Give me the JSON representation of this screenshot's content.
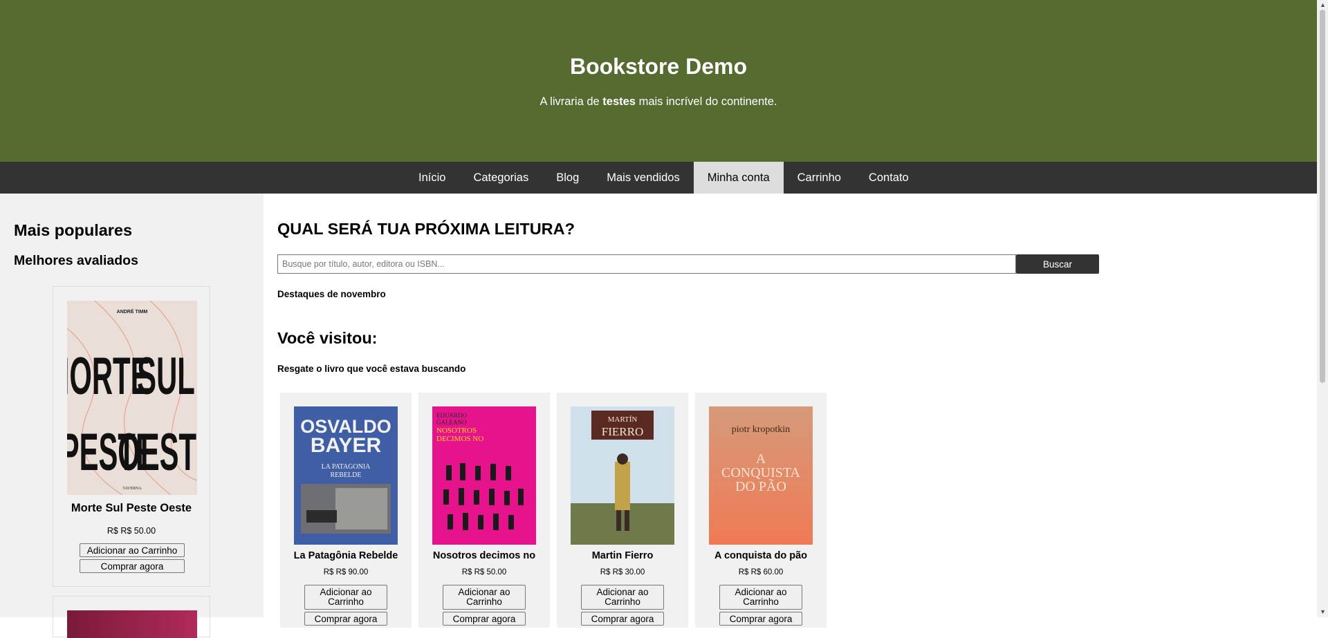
{
  "header": {
    "title": "Bookstore Demo",
    "tagline_pre": "A livraria de ",
    "tagline_bold": "testes",
    "tagline_post": " mais incrível do continente."
  },
  "nav": {
    "items": [
      "Início",
      "Categorias",
      "Blog",
      "Mais vendidos",
      "Minha conta",
      "Carrinho",
      "Contato"
    ],
    "active": "Minha conta"
  },
  "sidebar": {
    "title": "Mais populares",
    "subtitle": "Melhores avaliados",
    "featured": {
      "cover_author": "ANDRÉ TIMM",
      "cover_lines": [
        "MORTE",
        "SUL",
        "PESTE",
        "OESTE"
      ],
      "cover_publisher": "TAVERNA",
      "name": "Morte Sul Peste Oeste",
      "price": "R$ R$ 50.00",
      "add_label": "Adicionar ao Carrinho",
      "buy_label": "Comprar agora"
    }
  },
  "main": {
    "heading": "QUAL SERÁ TUA PRÓXIMA LEITURA?",
    "search_placeholder": "Busque por título, autor, editora ou ISBN...",
    "search_button": "Buscar",
    "highlights": "Destaques de novembro",
    "visited_heading": "Você visitou:",
    "visited_sub": "Resgate o livro que você estava buscando",
    "add_label_1": "Adicionar ao",
    "add_label_2": "Carrinho",
    "buy_label": "Comprar agora",
    "books": [
      {
        "title": "La Patagônia Rebelde",
        "price": "R$ R$ 90.00",
        "cover_l1": "OSVALDO",
        "cover_l2": "BAYER",
        "cover_l3": "LA PATAGONIA",
        "cover_l4": "REBELDE"
      },
      {
        "title": "Nosotros decimos no",
        "price": "R$ R$ 50.00",
        "cover_l1": "EDUARDO",
        "cover_l2": "GALEANO",
        "cover_l3": "NOSOTROS",
        "cover_l4": "DECIMOS NO"
      },
      {
        "title": "Martin Fierro",
        "price": "R$ R$ 30.00",
        "cover_l1": "MARTÍN",
        "cover_l2": "FIERRO",
        "cover_l3": "",
        "cover_l4": ""
      },
      {
        "title": "A conquista do pão",
        "price": "R$ R$ 60.00",
        "cover_l1": "piotr kropotkin",
        "cover_l2": "A",
        "cover_l3": "CONQUISTA",
        "cover_l4": "DO PÃO"
      }
    ]
  },
  "colors": {
    "header_bg": "#556b2f",
    "nav_bg": "#333333",
    "nav_active_bg": "#dddddd",
    "sidebar_bg": "#f1f1f1"
  }
}
